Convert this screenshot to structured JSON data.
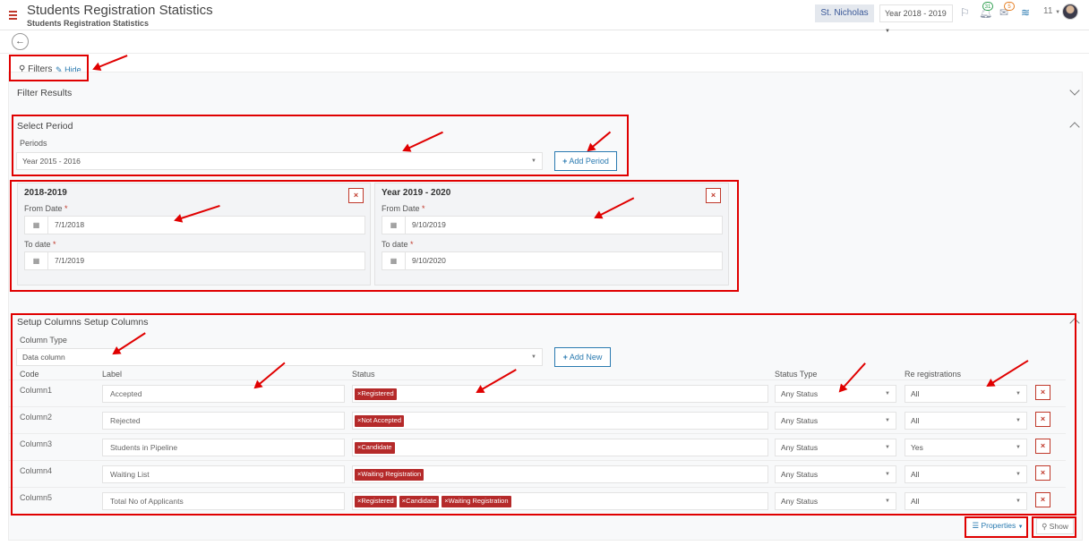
{
  "header": {
    "title": "Students Registration Statistics",
    "subtitle": "Students Registration Statistics",
    "school": "St. Nicholas",
    "year": "Year 2018 - 2019",
    "notif_count": "31",
    "mail_count": "5",
    "user_number": "11"
  },
  "filters": {
    "label": "Filters",
    "hide_label": "Hide"
  },
  "filter_results": {
    "title": "Filter Results"
  },
  "select_period": {
    "title": "Select Period",
    "periods_label": "Periods",
    "period_value": "Year 2015 - 2016",
    "add_period_label": "Add Period"
  },
  "period_cards": [
    {
      "title": "2018-2019",
      "from_label": "From Date",
      "from_value": "7/1/2018",
      "to_label": "To date",
      "to_value": "7/1/2019"
    },
    {
      "title": "Year 2019 - 2020",
      "from_label": "From Date",
      "from_value": "9/10/2019",
      "to_label": "To date",
      "to_value": "9/10/2020"
    }
  ],
  "setup_columns": {
    "title": "Setup Columns Setup Columns",
    "column_type_label": "Column Type",
    "column_type_value": "Data column",
    "add_new_label": "Add New",
    "headers": {
      "code": "Code",
      "label": "Label",
      "status": "Status",
      "status_type": "Status Type",
      "re_registrations": "Re registrations"
    },
    "rows": [
      {
        "code": "Column1",
        "label": "Accepted",
        "tags": [
          "Registered"
        ],
        "status_type": "Any Status",
        "re_reg": "All"
      },
      {
        "code": "Column2",
        "label": "Rejected",
        "tags": [
          "Not Accepted"
        ],
        "status_type": "Any Status",
        "re_reg": "All"
      },
      {
        "code": "Column3",
        "label": "Students in Pipeline",
        "tags": [
          "Candidate"
        ],
        "status_type": "Any Status",
        "re_reg": "Yes"
      },
      {
        "code": "Column4",
        "label": "Waiting List",
        "tags": [
          "Waiting Registration"
        ],
        "status_type": "Any Status",
        "re_reg": "All"
      },
      {
        "code": "Column5",
        "label": "Total No of Applicants",
        "tags": [
          "Registered",
          "Candidate",
          "Waiting Registration"
        ],
        "status_type": "Any Status",
        "re_reg": "All"
      }
    ]
  },
  "footer": {
    "properties_label": "Properties",
    "show_label": "Show"
  },
  "colors": {
    "accent": "#2a7ab0",
    "tag": "#b52a2a",
    "highlight": "#e00000"
  }
}
